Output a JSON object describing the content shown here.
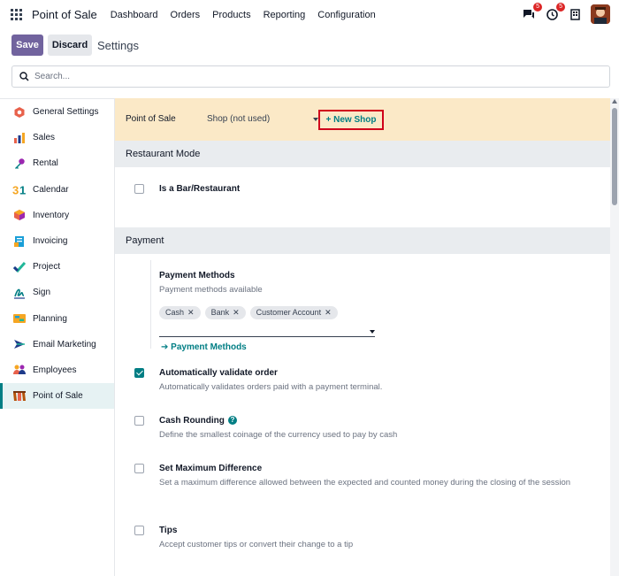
{
  "navbar": {
    "brand": "Point of Sale",
    "menu": [
      "Dashboard",
      "Orders",
      "Products",
      "Reporting",
      "Configuration"
    ],
    "messages_count": "5",
    "activities_count": "5"
  },
  "control": {
    "save_label": "Save",
    "discard_label": "Discard",
    "title": "Settings",
    "search_placeholder": "Search..."
  },
  "sidebar": {
    "items": [
      {
        "label": "General Settings",
        "icon": "general-settings-icon",
        "color": "#e8614b"
      },
      {
        "label": "Sales",
        "icon": "sales-icon",
        "color": "#e8614b"
      },
      {
        "label": "Rental",
        "icon": "rental-icon",
        "color": "#9c27b0"
      },
      {
        "label": "Calendar",
        "icon": "calendar-icon",
        "color": "#f5a623"
      },
      {
        "label": "Inventory",
        "icon": "inventory-icon",
        "color": "#e8614b"
      },
      {
        "label": "Invoicing",
        "icon": "invoicing-icon",
        "color": "#1a9fd8"
      },
      {
        "label": "Project",
        "icon": "project-icon",
        "color": "#21b799"
      },
      {
        "label": "Sign",
        "icon": "sign-icon",
        "color": "#017e84"
      },
      {
        "label": "Planning",
        "icon": "planning-icon",
        "color": "#f5a623"
      },
      {
        "label": "Email Marketing",
        "icon": "email-marketing-icon",
        "color": "#1e3a8a"
      },
      {
        "label": "Employees",
        "icon": "employees-icon",
        "color": "#9c27b0"
      },
      {
        "label": "Point of Sale",
        "icon": "point-of-sale-icon",
        "color": "#b45309",
        "active": true
      }
    ]
  },
  "pos": {
    "label": "Point of Sale",
    "selected_shop": "Shop (not used)",
    "new_shop_label": "+ New Shop"
  },
  "sections": {
    "restaurant": "Restaurant Mode",
    "payment": "Payment"
  },
  "settings": {
    "bar": {
      "title": "Is a Bar/Restaurant",
      "checked": false
    },
    "payment_methods": {
      "title": "Payment Methods",
      "desc": "Payment methods available",
      "tags": [
        "Cash",
        "Bank",
        "Customer Account"
      ],
      "link": "Payment Methods"
    },
    "auto_validate": {
      "title": "Automatically validate order",
      "desc": "Automatically validates orders paid with a payment terminal.",
      "checked": true
    },
    "cash_rounding": {
      "title": "Cash Rounding",
      "desc": "Define the smallest coinage of the currency used to pay by cash",
      "checked": false
    },
    "max_diff": {
      "title": "Set Maximum Difference",
      "desc": "Set a maximum difference allowed between the expected and counted money during the closing of the session",
      "checked": false
    },
    "tips": {
      "title": "Tips",
      "desc": "Accept customer tips or convert their change to a tip",
      "checked": false
    }
  },
  "colors": {
    "accent": "#017e84",
    "primary": "#71639e",
    "highlight": "#d0021b"
  }
}
